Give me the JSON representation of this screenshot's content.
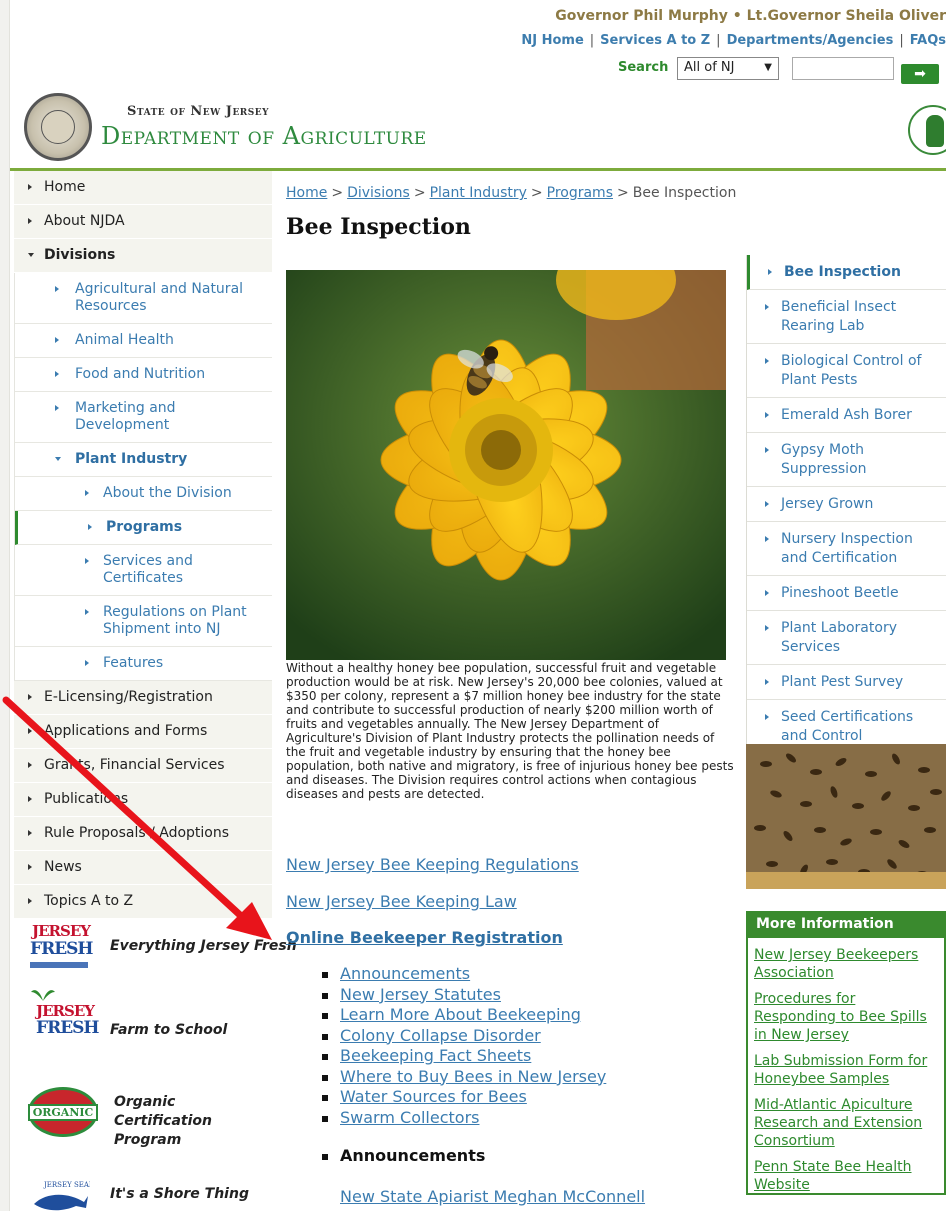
{
  "header": {
    "governor": "Governor Phil Murphy • Lt.Governor Sheila Oliver",
    "topnav": [
      "NJ Home",
      "Services A to Z",
      "Departments/Agencies",
      "FAQs"
    ],
    "search_label": "Search",
    "search_scope": "All of NJ",
    "search_placeholder": "",
    "state_name": "State of New Jersey",
    "dept_name": "Department of Agriculture"
  },
  "leftnav": {
    "items_top": [
      "Home",
      "About NJDA",
      "Divisions"
    ],
    "divisions": [
      "Agricultural and Natural Resources",
      "Animal Health",
      "Food and Nutrition",
      "Marketing and Development",
      "Plant Industry"
    ],
    "plant_industry": [
      "About the Division",
      "Programs",
      "Services and Certificates",
      "Regulations on Plant Shipment into NJ",
      "Features"
    ],
    "items_bottom": [
      "E-Licensing/Registration",
      "Applications and Forms",
      "Grants, Financial Services",
      "Publications",
      "Rule Proposals / Adoptions",
      "News",
      "Topics A to Z"
    ]
  },
  "promos": [
    {
      "label": "Everything Jersey Fresh",
      "logo_top": "JERSEY",
      "logo_bottom": "FRESH"
    },
    {
      "label": "Farm to School",
      "logo_top": "JERSEY",
      "logo_bottom": "FRESH"
    },
    {
      "label": "Organic Certification Program",
      "logo_text": "ORGANIC"
    },
    {
      "label": "It's a Shore Thing",
      "logo_text": "JERSEY SEAFOOD"
    }
  ],
  "breadcrumb": [
    "Home",
    "Divisions",
    "Plant Industry",
    "Programs",
    "Bee Inspection"
  ],
  "page_title": "Bee Inspection",
  "intro": "Without a healthy honey bee population, successful fruit and vegetable production would be at risk. New Jersey's 20,000 bee colonies, valued at $350 per colony, represent a $7 million honey bee industry for the state and contribute to successful production of nearly $200 million worth of fruits and vegetables annually. The New Jersey Department of Agriculture's Division of Plant Industry protects the pollination needs of the fruit and vegetable industry by ensuring that the honey bee population, both native and migratory, is free of injurious honey bee pests and diseases. The Division requires control actions when contagious diseases and pests are detected.",
  "main_links": [
    "New Jersey Bee Keeping Regulations",
    "New Jersey Bee Keeping Law",
    "Online Beekeeper Registration"
  ],
  "bullet_links": [
    "Announcements",
    "New Jersey Statutes",
    "Learn More About Beekeeping",
    "Colony Collapse Disorder",
    "Beekeeping Fact Sheets",
    "Where to Buy Bees in New Jersey",
    "Water Sources for Bees",
    "Swarm Collectors"
  ],
  "announcements_heading": "Announcements",
  "announcement_link": "New State Apiarist Meghan McConnell",
  "rightnav": [
    "Bee Inspection",
    "Beneficial Insect Rearing Lab",
    "Biological Control of Plant Pests",
    "Emerald Ash Borer",
    "Gypsy Moth Suppression",
    "Jersey Grown",
    "Nursery Inspection and Certification",
    "Pineshoot Beetle",
    "Plant Laboratory Services",
    "Plant Pest Survey",
    "Seed Certifications and Control"
  ],
  "more_info": {
    "heading": "More Information",
    "links": [
      "New Jersey Beekeepers Association",
      "Procedures for Responding to Bee Spills in New Jersey",
      "Lab Submission Form for Honeybee Samples",
      "Mid-Atlantic Apiculture Research and Extension Consortium",
      "Penn State Bee Health Website"
    ]
  },
  "colors": {
    "brand_green": "#2e8a3e",
    "link_blue": "#3b7cb0",
    "annotation_red": "#e8141b"
  }
}
